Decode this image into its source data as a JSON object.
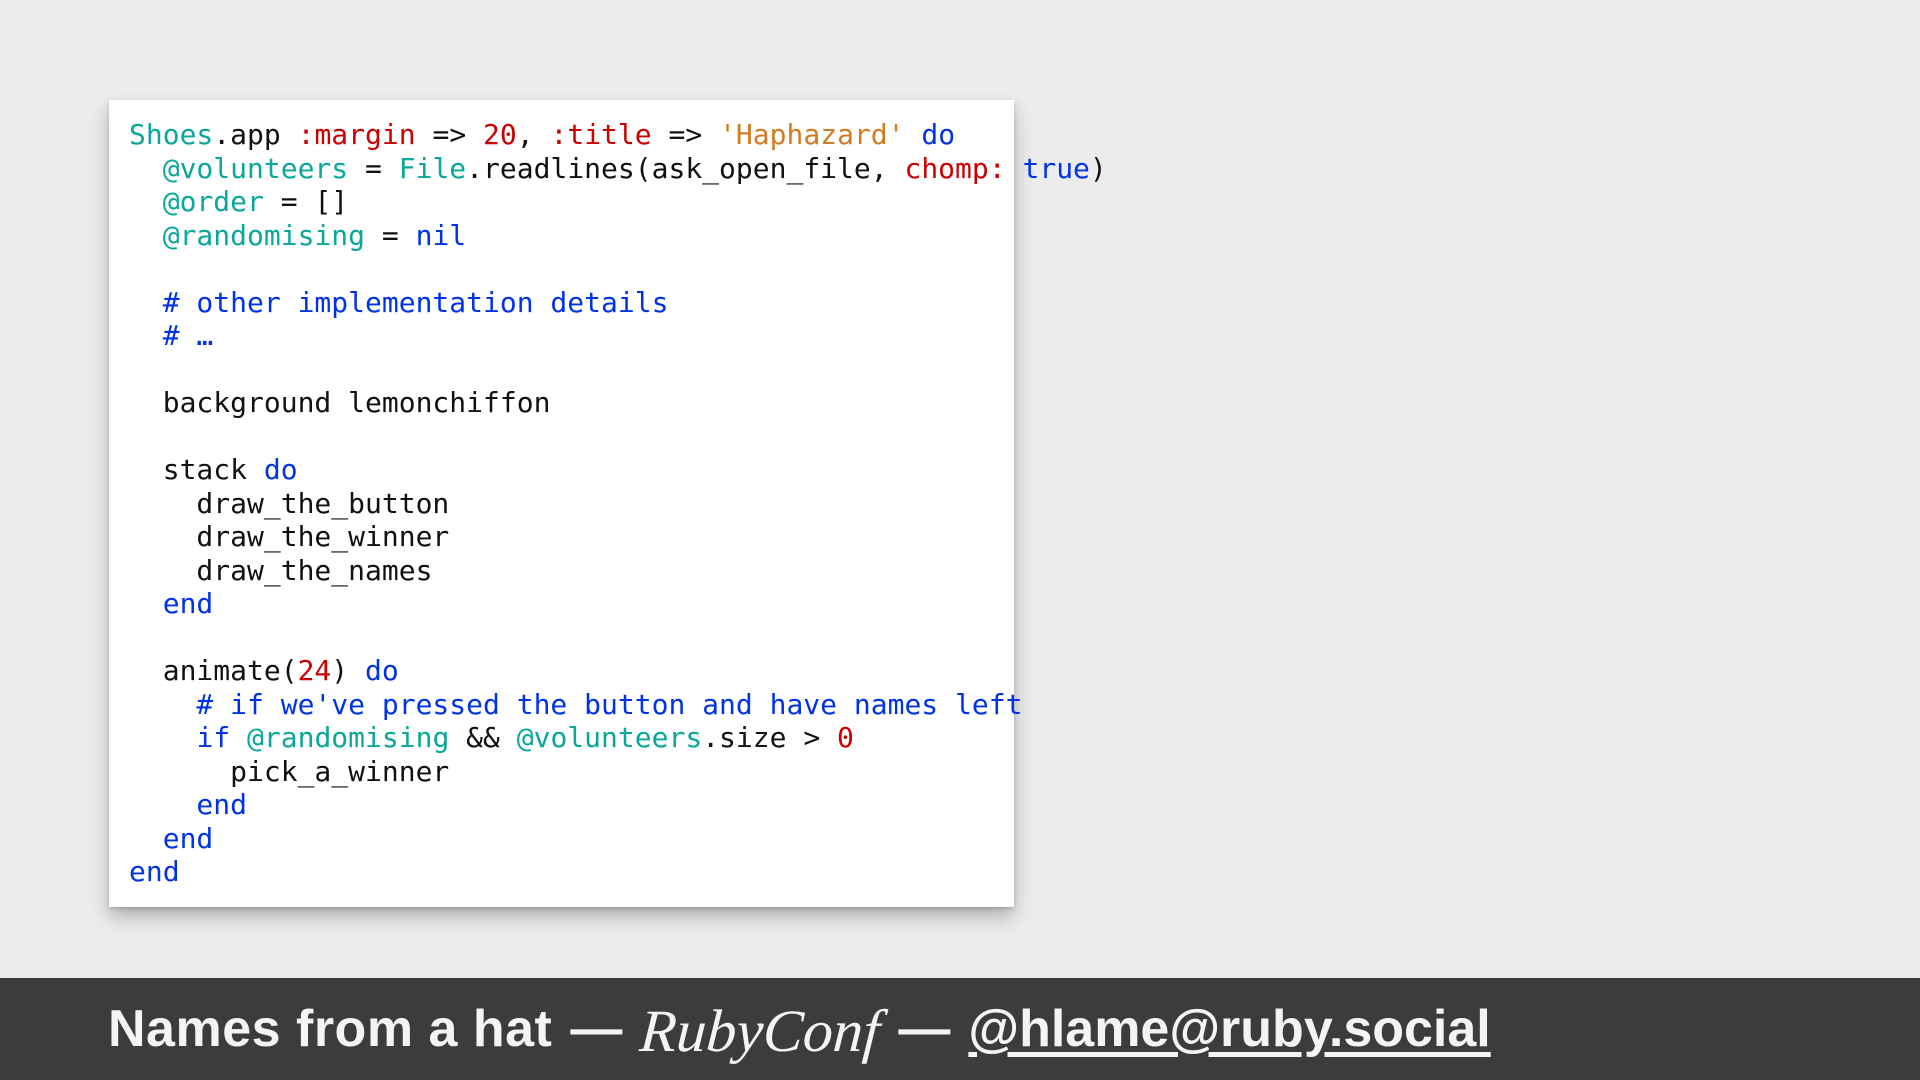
{
  "code": {
    "line01": {
      "a": "Shoes",
      "b": ".app ",
      "c": ":margin",
      "d": " => ",
      "e": "20",
      "f": ", ",
      "g": ":title",
      "h": " => ",
      "i": "'Haphazard'",
      "j": " ",
      "k": "do"
    },
    "line02": {
      "a": "  ",
      "b": "@volunteers",
      "c": " = ",
      "d": "File",
      "e": ".readlines(ask_open_file, ",
      "f": "chomp:",
      "g": " ",
      "h": "true",
      "i": ")"
    },
    "line03": {
      "a": "  ",
      "b": "@order",
      "c": " = []"
    },
    "line04": {
      "a": "  ",
      "b": "@randomising",
      "c": " = ",
      "d": "nil"
    },
    "line05": " ",
    "line06": "  # other implementation details",
    "line07": "  # …",
    "line08": " ",
    "line09": "  background lemonchiffon",
    "line10": " ",
    "line11": {
      "a": "  stack ",
      "b": "do"
    },
    "line12": "    draw_the_button",
    "line13": "    draw_the_winner",
    "line14": "    draw_the_names",
    "line15": "  end",
    "line16": " ",
    "line17": {
      "a": "  animate(",
      "b": "24",
      "c": ") ",
      "d": "do"
    },
    "line18": "    # if we've pressed the button and have names left",
    "line19": {
      "a": "    ",
      "b": "if",
      "c": " ",
      "d": "@randomising",
      "e": " && ",
      "f": "@volunteers",
      "g": ".size > ",
      "h": "0"
    },
    "line20": "      pick_a_winner",
    "line21": "    end",
    "line22": "  end",
    "line23": "end"
  },
  "footer": {
    "title": "Names from a hat",
    "sep": "—",
    "logo": "RubyConf",
    "handle": "@hlame@ruby.social"
  }
}
